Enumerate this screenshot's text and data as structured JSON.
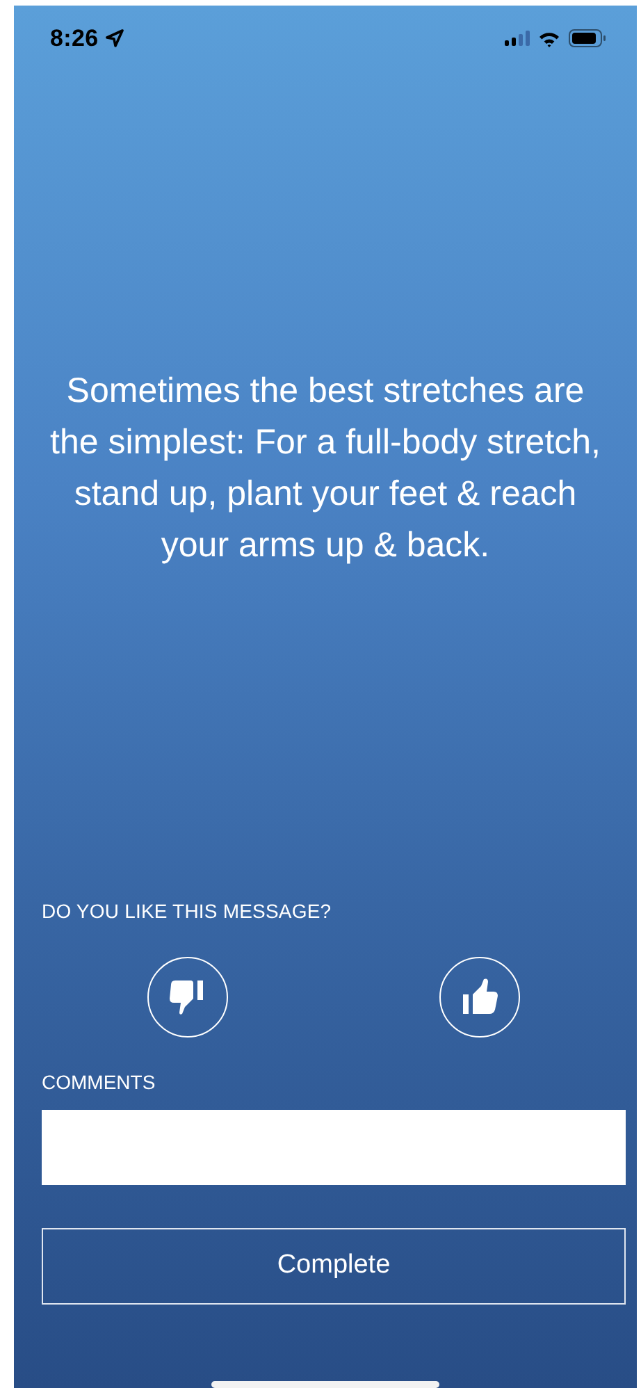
{
  "status_bar": {
    "time": "8:26"
  },
  "message": "Sometimes the best stretches are the simplest: For a full-body stretch, stand up, plant your feet & reach your arms up & back.",
  "feedback": {
    "question": "DO YOU LIKE THIS MESSAGE?"
  },
  "comments": {
    "label": "COMMENTS"
  },
  "complete_button": "Complete"
}
